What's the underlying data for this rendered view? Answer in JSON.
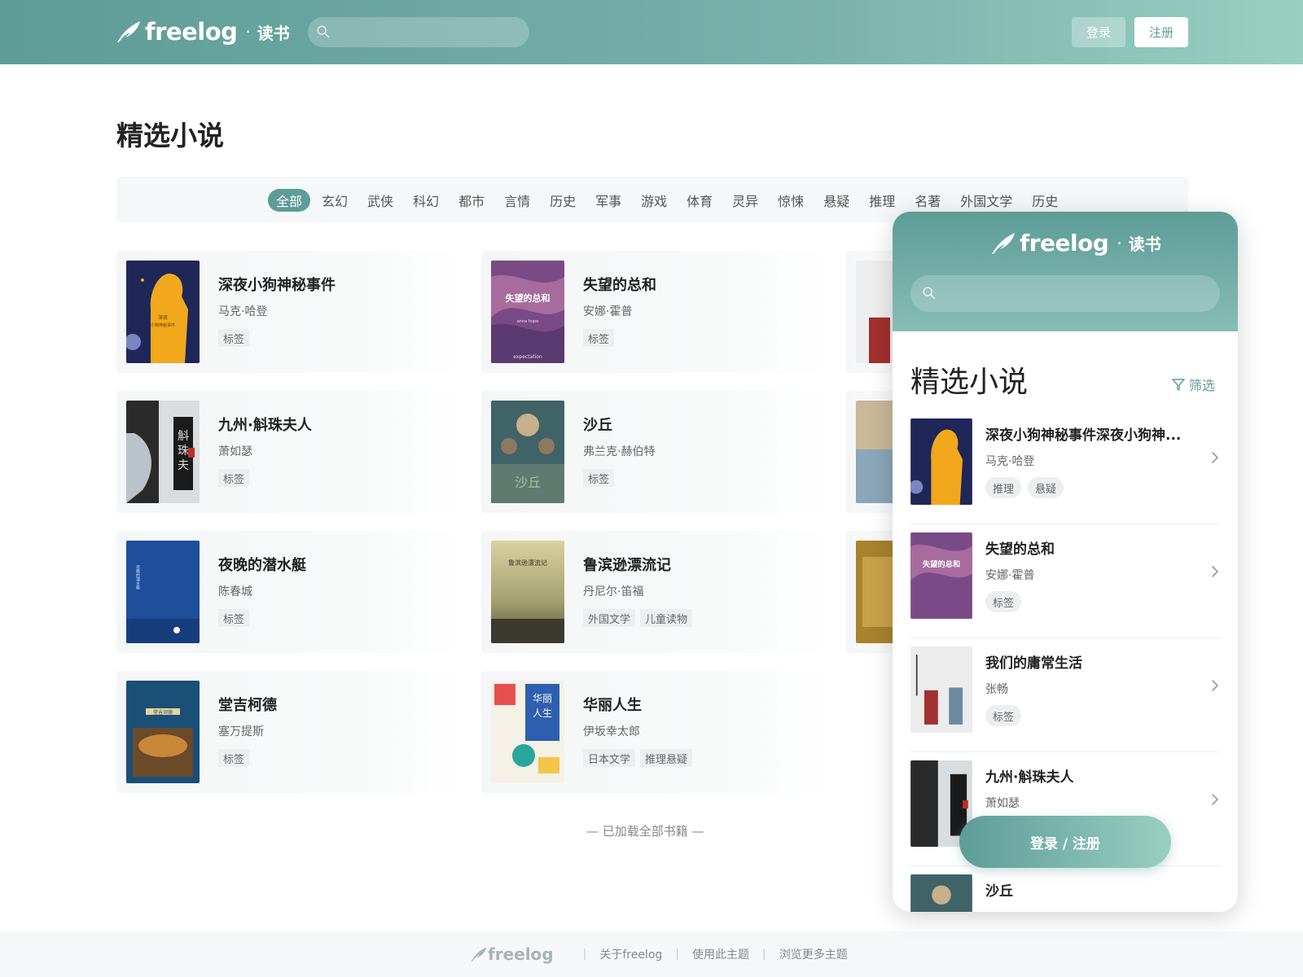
{
  "brand": {
    "name": "freelog",
    "dot": "·",
    "section": "读书"
  },
  "header": {
    "login": "登录",
    "register": "注册",
    "search_placeholder": ""
  },
  "page_title": "精选小说",
  "categories": [
    {
      "label": "全部",
      "active": true
    },
    {
      "label": "玄幻"
    },
    {
      "label": "武侠"
    },
    {
      "label": "科幻"
    },
    {
      "label": "都市"
    },
    {
      "label": "言情"
    },
    {
      "label": "历史"
    },
    {
      "label": "军事"
    },
    {
      "label": "游戏"
    },
    {
      "label": "体育"
    },
    {
      "label": "灵异"
    },
    {
      "label": "惊悚"
    },
    {
      "label": "悬疑"
    },
    {
      "label": "推理"
    },
    {
      "label": "名著"
    },
    {
      "label": "外国文学"
    },
    {
      "label": "历史"
    }
  ],
  "books": [
    {
      "title": "深夜小狗神秘事件",
      "author": "马克·哈登",
      "tags": [
        "标签"
      ]
    },
    {
      "title": "失望的总和",
      "author": "安娜·霍普",
      "tags": [
        "标签"
      ]
    },
    {
      "title": "九州·斛珠夫人",
      "author": "萧如瑟",
      "tags": [
        "标签"
      ]
    },
    {
      "title": "沙丘",
      "author": "弗兰克·赫伯特",
      "tags": [
        "标签"
      ]
    },
    {
      "title": "夜晚的潜水艇",
      "author": "陈春城",
      "tags": [
        "标签"
      ]
    },
    {
      "title": "鲁滨逊漂流记",
      "author": "丹尼尔·笛福",
      "tags": [
        "外国文学",
        "儿童读物"
      ]
    },
    {
      "title": "堂吉柯德",
      "author": "塞万提斯",
      "tags": [
        "标签"
      ]
    },
    {
      "title": "华丽人生",
      "author": "伊坂幸太郎",
      "tags": [
        "日本文学",
        "推理悬疑"
      ]
    }
  ],
  "loaded_all": "— 已加载全部书籍 —",
  "footer": {
    "brand": "freelog",
    "links": [
      "关于freelog",
      "使用此主题",
      "浏览更多主题"
    ]
  },
  "mobile": {
    "search_placeholder": "",
    "title": "精选小说",
    "filter": "筛选",
    "cta": "登录 / 注册",
    "items": [
      {
        "title": "深夜小狗神秘事件深夜小狗神...",
        "author": "马克·哈登",
        "tags": [
          "推理",
          "悬疑"
        ]
      },
      {
        "title": "失望的总和",
        "author": "安娜·霍普",
        "tags": [
          "标签"
        ]
      },
      {
        "title": "我们的庸常生活",
        "author": "张畅",
        "tags": [
          "标签"
        ]
      },
      {
        "title": "九州·斛珠夫人",
        "author": "萧如瑟",
        "tags": []
      },
      {
        "title": "沙丘",
        "author": "",
        "tags": []
      }
    ]
  },
  "colors": {
    "accent": "#5e9c98",
    "accent_light": "#98cfc0"
  }
}
